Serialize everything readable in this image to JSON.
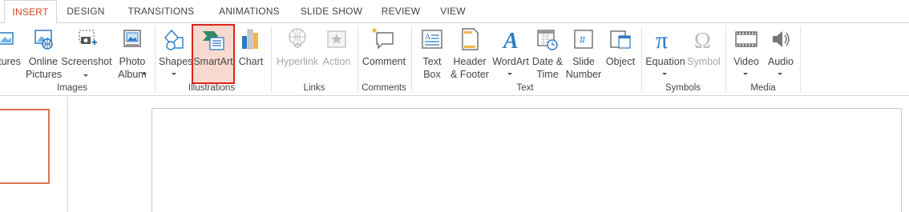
{
  "tabs": [
    "INSERT",
    "DESIGN",
    "TRANSITIONS",
    "ANIMATIONS",
    "SLIDE SHOW",
    "REVIEW",
    "VIEW"
  ],
  "ribbon": {
    "images": {
      "pictures": "tures",
      "online_pictures": [
        "Online",
        "Pictures"
      ],
      "screenshot": "Screenshot",
      "photo_album": [
        "Photo",
        "Album"
      ],
      "group_label": "Images"
    },
    "illustrations": {
      "shapes": "Shapes",
      "smartart": "SmartArt",
      "chart": "Chart",
      "group_label": "Illustrations"
    },
    "links": {
      "hyperlink": "Hyperlink",
      "action": "Action",
      "group_label": "Links"
    },
    "comments": {
      "comment": "Comment",
      "group_label": "Comments"
    },
    "text": {
      "text_box": [
        "Text",
        "Box"
      ],
      "header_footer": [
        "Header",
        "& Footer"
      ],
      "wordart": "WordArt",
      "date_time": [
        "Date &",
        "Time"
      ],
      "slide_number": [
        "Slide",
        "Number"
      ],
      "object": "Object",
      "group_label": "Text"
    },
    "symbols": {
      "equation": "Equation",
      "symbol": "Symbol",
      "group_label": "Symbols"
    },
    "media": {
      "video": "Video",
      "audio": "Audio",
      "group_label": "Media"
    }
  },
  "colors": {
    "accent": "#d24726",
    "highlight_border": "#d9261c",
    "highlight_fill": "#f7d9d0",
    "thumbnail_border": "#e0714a"
  },
  "icons": [
    "picture-icon",
    "online-pictures-icon",
    "screenshot-icon",
    "photo-album-icon",
    "shapes-icon",
    "smartart-icon",
    "chart-icon",
    "hyperlink-icon",
    "action-icon",
    "comment-icon",
    "text-box-icon",
    "header-footer-icon",
    "wordart-icon",
    "date-time-icon",
    "slide-number-icon",
    "object-icon",
    "equation-icon",
    "symbol-icon",
    "video-icon",
    "audio-icon"
  ]
}
